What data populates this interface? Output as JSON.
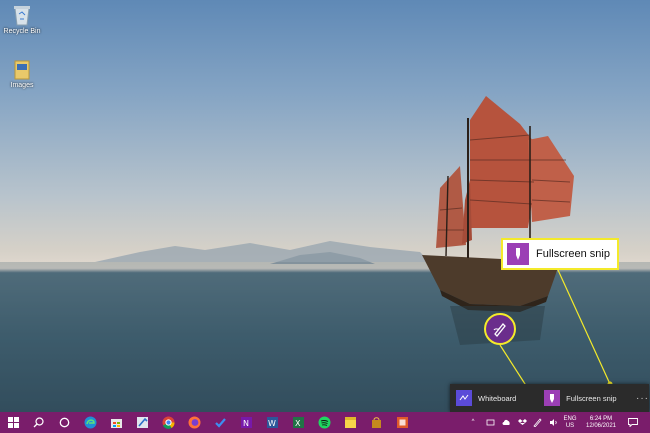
{
  "desktop": {
    "icons": [
      {
        "label": "Recycle Bin",
        "icon": "recycle-bin-icon"
      },
      {
        "label": "Images",
        "icon": "folder-icon"
      }
    ]
  },
  "callout": {
    "label": "Fullscreen snip",
    "highlight_color": "#f4ea2a"
  },
  "pen_menu": {
    "items": [
      {
        "label": "Whiteboard",
        "icon": "whiteboard-icon"
      },
      {
        "label": "Fullscreen snip",
        "icon": "snip-icon"
      }
    ],
    "more": "···"
  },
  "taskbar": {
    "color": "#7a1d6b",
    "apps": [
      "start-icon",
      "search-icon",
      "cortana-icon",
      "edge-icon",
      "store-icon",
      "snip-sketch-icon",
      "chrome-icon",
      "firefox-icon",
      "todo-icon",
      "onenote-icon",
      "word-icon",
      "excel-icon",
      "spotify-icon",
      "sticky-notes-icon",
      "shop-bag-icon",
      "camera-icon"
    ],
    "tray": {
      "chevron": "^",
      "language": "ENG",
      "region": "US",
      "time": "6:24 PM",
      "date": "12/06/2021"
    }
  }
}
